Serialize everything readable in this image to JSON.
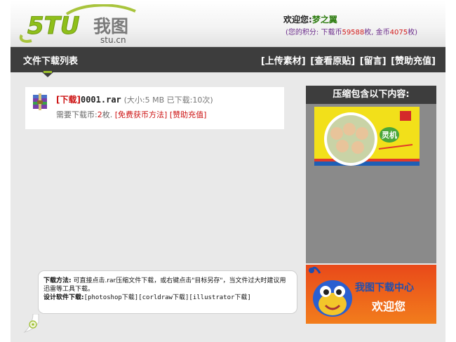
{
  "header": {
    "logo_text": "5TU我图",
    "logo_domain": "stu.cn",
    "welcome_prefix": "欢迎您:",
    "username": "梦之翼",
    "points_prefix": "(您的积分: 下载币",
    "download_coins": "59588",
    "points_mid": "枚, 金币",
    "gold_coins": "4075",
    "points_suffix": "枚)"
  },
  "nav": {
    "title": "文件下载列表",
    "links": [
      "[上传素材]",
      "[查看原贴]",
      "[留言]",
      "[赞助充值]"
    ]
  },
  "file": {
    "download_tag": "[下载]",
    "filename": "0001.rar",
    "meta": "(大小:5 MB 已下载:10次)",
    "cost_prefix": "需要下载币:",
    "cost_value": "2",
    "cost_suffix": "枚.",
    "free_link": "[免费获币方法]",
    "recharge_link": "[赞助充值]"
  },
  "right": {
    "panel_title": "压缩包含以下内容:",
    "banner_line1": "我图下载中心",
    "banner_line2": "欢迎您"
  },
  "tip": {
    "method_label": "下载方法:",
    "method_text": "可直接点击.rar压缩文件下载，或右键点击\"目标另存\"，当文件过大时建议用迅雷等工具下载。",
    "software_label": "设计软件下载:",
    "software_links": "[photoshop下载][corldraw下载][illustrator下载]"
  },
  "colors": {
    "nav_bg": "#3d3d3d",
    "accent_green": "#9bbe2a",
    "link_red": "#cc1111",
    "username_green": "#2f7d12",
    "points_purple": "#6a2a8a"
  }
}
